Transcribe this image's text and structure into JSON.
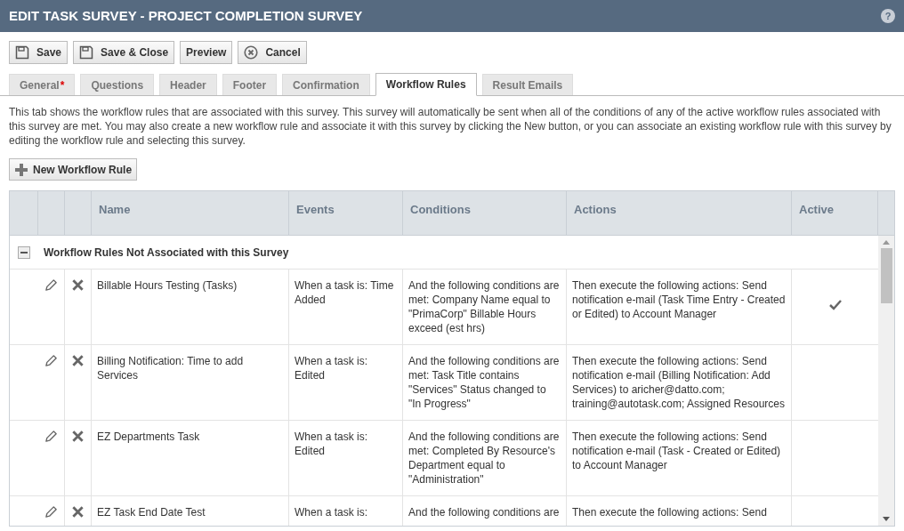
{
  "window": {
    "title": "EDIT TASK SURVEY - PROJECT COMPLETION SURVEY",
    "help": "?"
  },
  "toolbar": [
    {
      "label": "Save",
      "kind": "save"
    },
    {
      "label": "Save & Close",
      "kind": "save"
    },
    {
      "label": "Preview",
      "kind": "plain"
    },
    {
      "label": "Cancel",
      "kind": "cancel"
    }
  ],
  "tabs": [
    {
      "label": "General",
      "required": true,
      "required_mark": "*",
      "selected": false
    },
    {
      "label": "Questions",
      "required": false,
      "selected": false
    },
    {
      "label": "Header",
      "required": false,
      "selected": false
    },
    {
      "label": "Footer",
      "required": false,
      "selected": false
    },
    {
      "label": "Confirmation",
      "required": false,
      "selected": false
    },
    {
      "label": "Workflow Rules",
      "required": false,
      "selected": true
    },
    {
      "label": "Result Emails",
      "required": false,
      "selected": false
    }
  ],
  "description": "This tab shows the workflow rules that are associated with this survey. This survey will automatically be sent when all of the conditions of any of the active workflow rules associated with this survey are met. You may also create a new workflow rule and associate it with this survey by clicking the New button, or you can associate an existing workflow rule with this survey by editing the workflow rule and selecting this survey.",
  "new_button": {
    "label": "New Workflow Rule"
  },
  "table": {
    "columns": [
      "Name",
      "Events",
      "Conditions",
      "Actions",
      "Active"
    ],
    "group": {
      "label": "Workflow Rules Not Associated with this Survey",
      "expanded": true
    },
    "rows": [
      {
        "name": "Billable Hours Testing (Tasks)",
        "events": "When a task is: Time Added",
        "conditions": "And the following conditions are met: Company Name equal to \"PrimaCorp\" Billable Hours exceed (est hrs)",
        "actions": "Then execute the following actions: Send notification e-mail (Task Time Entry - Created or Edited) to Account Manager",
        "active": true
      },
      {
        "name": "Billing Notification: Time to add Services",
        "events": "When a task is: Edited",
        "conditions": "And the following conditions are met: Task Title contains \"Services\" Status changed to \"In Progress\"",
        "actions": "Then execute the following actions: Send notification e-mail (Billing Notification: Add Services) to aricher@datto.com; training@autotask.com; Assigned Resources",
        "active": false
      },
      {
        "name": "EZ Departments Task",
        "events": "When a task is: Edited",
        "conditions": "And the following conditions are met: Completed By Resource's Department equal to \"Administration\"",
        "actions": "Then execute the following actions: Send notification e-mail (Task - Created or Edited) to Account Manager",
        "active": false
      },
      {
        "name": "EZ Task End Date Test",
        "events": "When a task is:",
        "conditions": "And the following conditions are",
        "actions": "Then execute the following actions: Send",
        "active": false
      }
    ]
  }
}
